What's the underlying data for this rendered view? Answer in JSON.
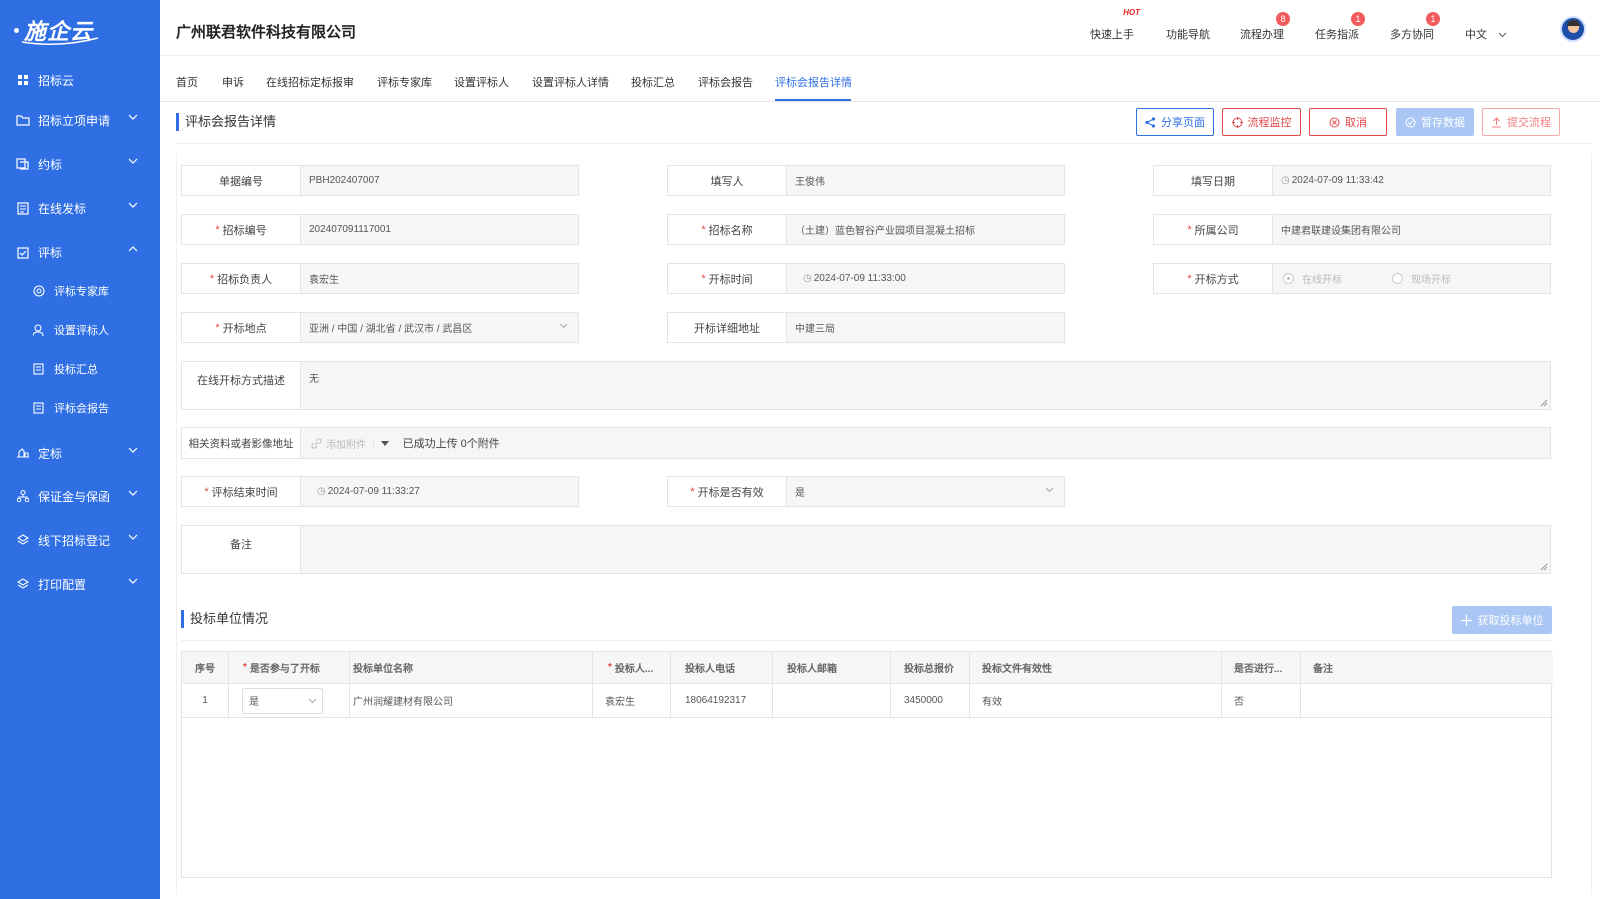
{
  "sidebar": {
    "logo": "施企云",
    "items": [
      {
        "label": "招标云",
        "icon": "grid-icon",
        "expanded": null
      },
      {
        "label": "招标立项申请",
        "icon": "folder-icon",
        "expanded": false
      },
      {
        "label": "约标",
        "icon": "stack-icon",
        "expanded": false
      },
      {
        "label": "在线发标",
        "icon": "doc-icon",
        "expanded": false
      },
      {
        "label": "评标",
        "icon": "check-doc-icon",
        "expanded": true
      },
      {
        "label": "评标专家库",
        "icon": "expert-icon",
        "sub": true
      },
      {
        "label": "设置评标人",
        "icon": "user-set-icon",
        "sub": true
      },
      {
        "label": "投标汇总",
        "icon": "summary-icon",
        "sub": true
      },
      {
        "label": "评标会报告",
        "icon": "report-icon",
        "sub": true
      },
      {
        "label": "定标",
        "icon": "hand-icon",
        "expanded": false
      },
      {
        "label": "保证金与保函",
        "icon": "network-icon",
        "expanded": false
      },
      {
        "label": "线下招标登记",
        "icon": "layers-icon",
        "expanded": false
      },
      {
        "label": "打印配置",
        "icon": "layers-icon",
        "expanded": false
      }
    ]
  },
  "header": {
    "company": "广州联君软件科技有限公司",
    "quick_start": "快速上手",
    "hot": "HOT",
    "nav_guide": "功能导航",
    "flow": "流程办理",
    "flow_badge": "8",
    "tasks": "任务指派",
    "tasks_badge": "1",
    "collab": "多方协同",
    "collab_badge": "1",
    "language": "中文"
  },
  "tabs": [
    "首页",
    "申诉",
    "在线招标定标报审",
    "评标专家库",
    "设置评标人",
    "设置评标人详情",
    "投标汇总",
    "评标会报告",
    "评标会报告详情"
  ],
  "active_tab": "评标会报告详情",
  "page": {
    "title": "评标会报告详情",
    "buttons": {
      "share": "分享页面",
      "monitor": "流程监控",
      "cancel": "取消",
      "save": "暂存数据",
      "submit": "提交流程"
    }
  },
  "form": {
    "doc_no": {
      "label": "单据编号",
      "value": "PBH202407007"
    },
    "writer": {
      "label": "填写人",
      "value": "王俊伟"
    },
    "write_date": {
      "label": "填写日期",
      "value": "2024-07-09 11:33:42"
    },
    "bid_no": {
      "label": "招标编号",
      "value": "202407091117001"
    },
    "bid_name": {
      "label": "招标名称",
      "value": "（土建）蓝色智谷产业园项目混凝土招标"
    },
    "company": {
      "label": "所属公司",
      "value": "中建君联建设集团有限公司"
    },
    "bid_owner": {
      "label": "招标负责人",
      "value": "袁宏生"
    },
    "open_time": {
      "label": "开标时间",
      "value": "2024-07-09 11:33:00"
    },
    "open_method": {
      "label": "开标方式",
      "options": [
        "在线开标",
        "现场开标"
      ],
      "selected": "在线开标"
    },
    "open_place": {
      "label": "开标地点",
      "value": "亚洲 / 中国 / 湖北省 / 武汉市 / 武昌区"
    },
    "open_address": {
      "label": "开标详细地址",
      "value": "中建三局"
    },
    "online_desc": {
      "label": "在线开标方式描述",
      "value": "无"
    },
    "attachments": {
      "label": "相关资料或者影像地址",
      "add": "添加附件",
      "status": "已成功上传 0个附件"
    },
    "eval_end": {
      "label": "评标结束时间",
      "value": "2024-07-09 11:33:27"
    },
    "valid": {
      "label": "开标是否有效",
      "value": "是"
    },
    "remark": {
      "label": "备注",
      "value": ""
    }
  },
  "bidders": {
    "title": "投标单位情况",
    "fetch_button": "获取投标单位",
    "columns": [
      "序号",
      "是否参与了开标",
      "投标单位名称",
      "投标人...",
      "投标人电话",
      "投标人邮箱",
      "投标总报价",
      "投标文件有效性",
      "是否进行...",
      "备注"
    ],
    "rows": [
      {
        "no": "1",
        "joined": "是",
        "name": "广州润耀建材有限公司",
        "person": "袁宏生",
        "phone": "18064192317",
        "email": "",
        "price": "3450000",
        "validity": "有效",
        "done": "否",
        "remark": ""
      }
    ]
  }
}
